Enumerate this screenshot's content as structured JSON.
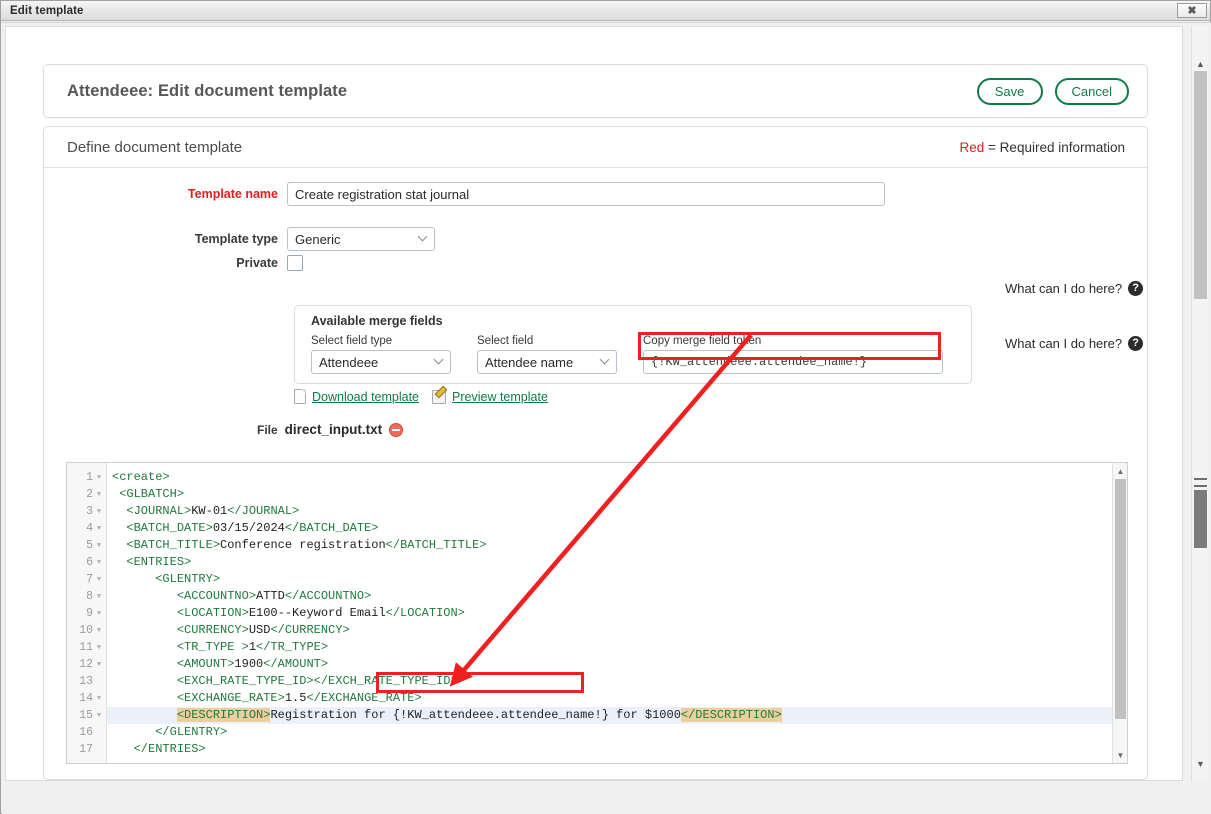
{
  "window": {
    "title": "Edit template",
    "close_label": "✖"
  },
  "header": {
    "title": "Attendeee: Edit document template",
    "save_label": "Save",
    "cancel_label": "Cancel"
  },
  "section": {
    "title": "Define document template",
    "required_note_red": "Red",
    "required_note_rest": " = Required information"
  },
  "form": {
    "template_name_label": "Template name",
    "template_name_value": "Create registration stat journal",
    "template_type_label": "Template type",
    "template_type_value": "Generic",
    "private_label": "Private"
  },
  "help": {
    "link1": "What can I do here?",
    "link2": "What can I do here?",
    "icon": "?"
  },
  "merge": {
    "panel_title": "Available merge fields",
    "field_type_label": "Select field type",
    "field_type_value": "Attendeee",
    "field_label": "Select field",
    "field_value": "Attendee name",
    "token_label": "Copy merge field token",
    "token_value": "{!KW_attendeee.attendee_name!}"
  },
  "links": {
    "download": "Download template",
    "preview": "Preview template"
  },
  "file": {
    "label": "File",
    "name": "direct_input.txt"
  },
  "editor": {
    "lines": [
      {
        "n": "1",
        "fold": true,
        "active": false,
        "segs": [
          {
            "t": "tag",
            "v": "<create>"
          }
        ]
      },
      {
        "n": "2",
        "fold": true,
        "active": false,
        "segs": [
          {
            "t": "plain",
            "v": " "
          },
          {
            "t": "tag",
            "v": "<GLBATCH>"
          }
        ]
      },
      {
        "n": "3",
        "fold": true,
        "active": false,
        "segs": [
          {
            "t": "plain",
            "v": "  "
          },
          {
            "t": "tag",
            "v": "<JOURNAL>"
          },
          {
            "t": "plain",
            "v": "KW-01"
          },
          {
            "t": "tag",
            "v": "</JOURNAL>"
          }
        ]
      },
      {
        "n": "4",
        "fold": true,
        "active": false,
        "segs": [
          {
            "t": "plain",
            "v": "  "
          },
          {
            "t": "tag",
            "v": "<BATCH_DATE>"
          },
          {
            "t": "plain",
            "v": "03/15/2024"
          },
          {
            "t": "tag",
            "v": "</BATCH_DATE>"
          }
        ]
      },
      {
        "n": "5",
        "fold": true,
        "active": false,
        "segs": [
          {
            "t": "plain",
            "v": "  "
          },
          {
            "t": "tag",
            "v": "<BATCH_TITLE>"
          },
          {
            "t": "plain",
            "v": "Conference registration"
          },
          {
            "t": "tag",
            "v": "</BATCH_TITLE>"
          }
        ]
      },
      {
        "n": "6",
        "fold": true,
        "active": false,
        "segs": [
          {
            "t": "plain",
            "v": "  "
          },
          {
            "t": "tag",
            "v": "<ENTRIES>"
          }
        ]
      },
      {
        "n": "7",
        "fold": true,
        "active": false,
        "segs": [
          {
            "t": "plain",
            "v": "      "
          },
          {
            "t": "tag",
            "v": "<GLENTRY>"
          }
        ]
      },
      {
        "n": "8",
        "fold": true,
        "active": false,
        "segs": [
          {
            "t": "plain",
            "v": "         "
          },
          {
            "t": "tag",
            "v": "<ACCOUNTNO>"
          },
          {
            "t": "plain",
            "v": "ATTD"
          },
          {
            "t": "tag",
            "v": "</ACCOUNTNO>"
          }
        ]
      },
      {
        "n": "9",
        "fold": true,
        "active": false,
        "segs": [
          {
            "t": "plain",
            "v": "         "
          },
          {
            "t": "tag",
            "v": "<LOCATION>"
          },
          {
            "t": "plain",
            "v": "E100--Keyword Email"
          },
          {
            "t": "tag",
            "v": "</LOCATION>"
          }
        ]
      },
      {
        "n": "10",
        "fold": true,
        "active": false,
        "segs": [
          {
            "t": "plain",
            "v": "         "
          },
          {
            "t": "tag",
            "v": "<CURRENCY>"
          },
          {
            "t": "plain",
            "v": "USD"
          },
          {
            "t": "tag",
            "v": "</CURRENCY>"
          }
        ]
      },
      {
        "n": "11",
        "fold": true,
        "active": false,
        "segs": [
          {
            "t": "plain",
            "v": "         "
          },
          {
            "t": "tag",
            "v": "<TR_TYPE >"
          },
          {
            "t": "plain",
            "v": "1"
          },
          {
            "t": "tag",
            "v": "</TR_TYPE>"
          }
        ]
      },
      {
        "n": "12",
        "fold": true,
        "active": false,
        "segs": [
          {
            "t": "plain",
            "v": "         "
          },
          {
            "t": "tag",
            "v": "<AMOUNT>"
          },
          {
            "t": "plain",
            "v": "1900"
          },
          {
            "t": "tag",
            "v": "</AMOUNT>"
          }
        ]
      },
      {
        "n": "13",
        "fold": false,
        "active": false,
        "segs": [
          {
            "t": "plain",
            "v": "         "
          },
          {
            "t": "tag",
            "v": "<EXCH_RATE_TYPE_ID>"
          },
          {
            "t": "tag",
            "v": "</EXCH_RATE_TYPE_ID>"
          }
        ]
      },
      {
        "n": "14",
        "fold": true,
        "active": false,
        "segs": [
          {
            "t": "plain",
            "v": "         "
          },
          {
            "t": "tag",
            "v": "<EXCHANGE_RATE>"
          },
          {
            "t": "plain",
            "v": "1.5"
          },
          {
            "t": "tag",
            "v": "</EXCHANGE_RATE>"
          }
        ]
      },
      {
        "n": "15",
        "fold": true,
        "active": true,
        "segs": [
          {
            "t": "plain",
            "v": "         "
          },
          {
            "t": "hl-tag",
            "v": "<DESCRIPTION>"
          },
          {
            "t": "plain",
            "v": "Registration for {!KW_attendeee.attendee_name!} for $1000"
          },
          {
            "t": "hl-tag",
            "v": "</DESCRIPTION>"
          }
        ]
      },
      {
        "n": "16",
        "fold": false,
        "active": false,
        "segs": [
          {
            "t": "plain",
            "v": "      "
          },
          {
            "t": "tag",
            "v": "</GLENTRY>"
          }
        ]
      },
      {
        "n": "17",
        "fold": false,
        "active": false,
        "segs": [
          {
            "t": "plain",
            "v": "   "
          },
          {
            "t": "tag",
            "v": "</ENTRIES>"
          }
        ]
      }
    ],
    "scroll_up": "▲",
    "scroll_down": "▼"
  },
  "scrollbar": {
    "up": "▲",
    "down": "▼"
  },
  "colors": {
    "accent_green": "#0f7b46",
    "required_red": "#e02020",
    "annotation_red": "#ef2020",
    "tag_green": "#1f7a3c",
    "highlight_tan": "#eccf9e",
    "active_line_blue": "#eaf1fb"
  }
}
